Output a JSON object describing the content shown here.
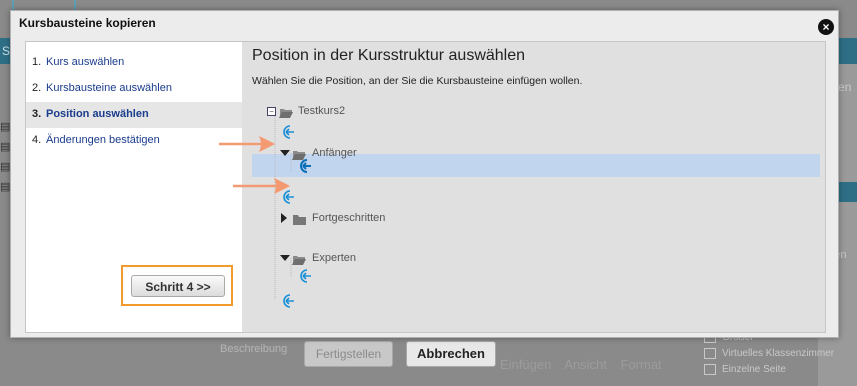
{
  "dialog": {
    "title": "Kursbausteine kopieren"
  },
  "steps": [
    {
      "num": "1.",
      "label": "Kurs auswählen"
    },
    {
      "num": "2.",
      "label": "Kursbausteine auswählen"
    },
    {
      "num": "3.",
      "label": "Position auswählen"
    },
    {
      "num": "4.",
      "label": "Änderungen bestätigen"
    }
  ],
  "next_button": "Schritt 4 >>",
  "main": {
    "title": "Position in der Kursstruktur auswählen",
    "description": "Wählen Sie die Position, an der Sie die Kursbausteine einfügen wollen."
  },
  "tree": {
    "root": "Testkurs2",
    "nodes": [
      "Anfänger",
      "Fortgeschritten",
      "Experten"
    ]
  },
  "background": {
    "bar_text": "Ste",
    "right_text": "ählen",
    "right_text2": "agen",
    "bottom_label": "Beschreibung",
    "footer_buttons": {
      "finish": "Fertigstellen",
      "cancel": "Abbrechen"
    },
    "toolbar": [
      "Einfügen",
      "Ansicht",
      "Format"
    ],
    "right_items": [
      "Größer",
      "Virtuelles Klassenzimmer",
      "Einzelne Seite"
    ]
  },
  "colors": {
    "accent_orange": "#f39a2c",
    "highlight": "#c2d5ef",
    "insert_icon": "#1a8fd8"
  }
}
